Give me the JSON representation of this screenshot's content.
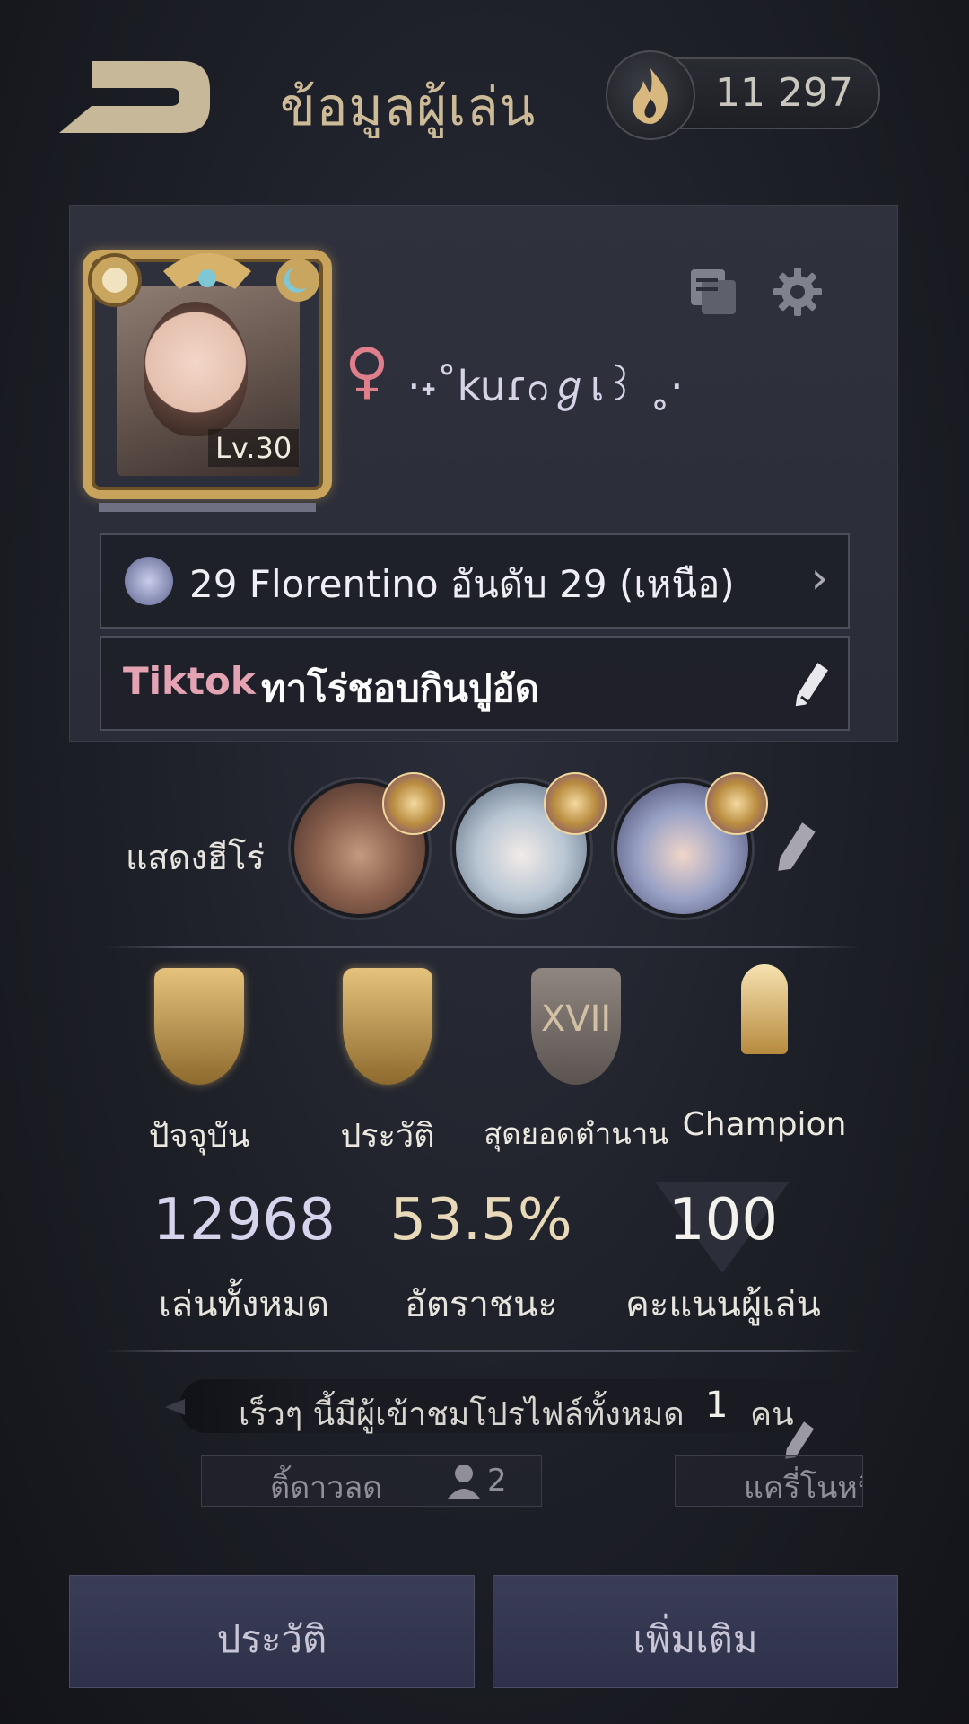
{
  "header": {
    "title": "ข้อมูลผู้เล่น",
    "currency_value": "11 297"
  },
  "profile": {
    "level": "Lv.30",
    "gender_symbol": "♀",
    "nickname": "·˖˚kuɾᦅℊเ꒱ ˳·",
    "rank_text": "29 Florentino อันดับ 29 (เหนือ)",
    "signature_tag": "Tiktok",
    "signature_text": "ทาโร่ชอบกินปูอัด"
  },
  "heroes": {
    "label": "แสดงฮีโร่"
  },
  "badges": [
    {
      "label": "ปัจจุบัน"
    },
    {
      "label": "ประวัติ"
    },
    {
      "label": "สุดยอดตำนาน",
      "roman": "XVII"
    },
    {
      "label": "Champion"
    }
  ],
  "stats": [
    {
      "value": "12968",
      "label": "เล่นทั้งหมด"
    },
    {
      "value": "53.5%",
      "label": "อัตราชนะ"
    },
    {
      "value": "100",
      "label": "คะแนนผู้เล่น"
    }
  ],
  "visitors": {
    "text": "เร็วๆ นี้มีผู้เข้าชมโปรไฟล์ทั้งหมด",
    "count": "1",
    "unit": "คน"
  },
  "tabs": [
    {
      "label": "ติ้ดาวลด",
      "count": "2"
    },
    {
      "label": "แครี่โนหนิ"
    }
  ],
  "buttons": {
    "history": "ประวัติ",
    "more": "เพิ่มเติม"
  },
  "colors": {
    "accent_gold": "#cdbb98",
    "gender_pink": "#e07f8c",
    "win_rate": "#e8d9b8"
  }
}
